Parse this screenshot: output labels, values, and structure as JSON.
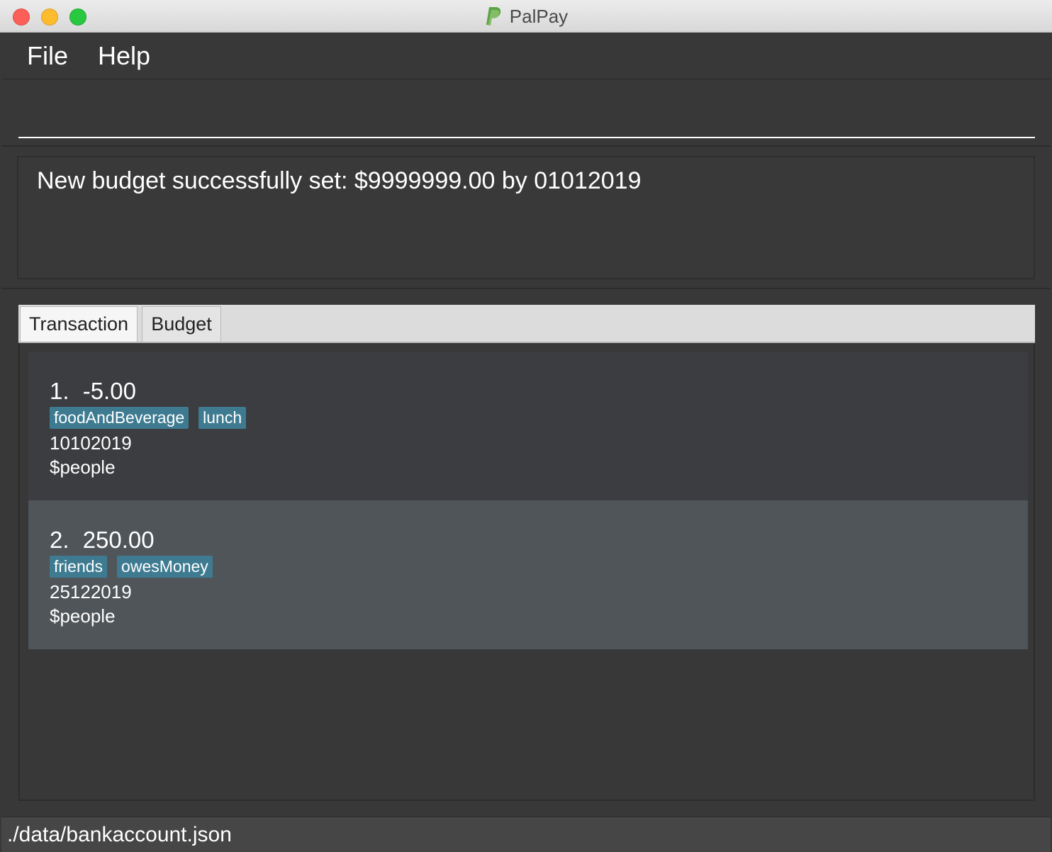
{
  "window": {
    "title": "PalPay"
  },
  "menu": {
    "items": [
      {
        "label": "File"
      },
      {
        "label": "Help"
      }
    ]
  },
  "command": {
    "value": "",
    "placeholder": ""
  },
  "result": {
    "text": "New budget successfully set: $9999999.00 by 01012019"
  },
  "tabs": [
    {
      "label": "Transaction",
      "selected": true
    },
    {
      "label": "Budget",
      "selected": false
    }
  ],
  "transactions": [
    {
      "index": "1.",
      "amount": "-5.00",
      "tags": [
        "foodAndBeverage",
        "lunch"
      ],
      "date": "10102019",
      "people": "$people"
    },
    {
      "index": "2.",
      "amount": "250.00",
      "tags": [
        "friends",
        "owesMoney"
      ],
      "date": "25122019",
      "people": "$people"
    }
  ],
  "status": {
    "path": "./data/bankaccount.json"
  },
  "colors": {
    "tag_background": "#3e7b91",
    "card_odd": "#3c3d40",
    "card_even": "#505559",
    "background": "#383838"
  },
  "icons": {
    "app_logo": "paypal-logo-icon"
  }
}
